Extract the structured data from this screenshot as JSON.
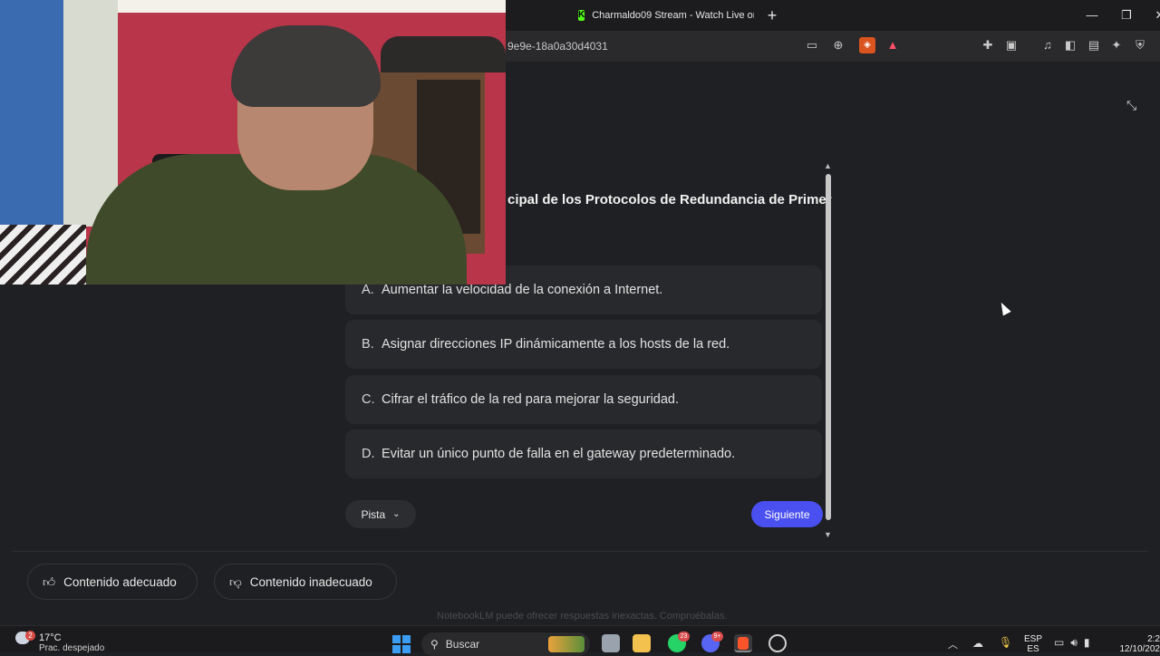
{
  "browser": {
    "tab_title": "Charmaldo09 Stream - Watch Live on",
    "tab_favicon": "kick-icon",
    "url_fragment": "9e9e-18a0a30d4031",
    "window_controls": {
      "minimize": "—",
      "restore": "❐",
      "close": "✕"
    }
  },
  "quiz": {
    "question_fragment": "cipal de los Protocolos de Redundancia de Primer",
    "options": [
      {
        "letter": "A.",
        "text": "Aumentar la velocidad de la conexión a Internet."
      },
      {
        "letter": "B.",
        "text": "Asignar direcciones IP dinámicamente a los hosts de la red."
      },
      {
        "letter": "C.",
        "text": "Cifrar el tráfico de la red para mejorar la seguridad."
      },
      {
        "letter": "D.",
        "text": "Evitar un único punto de falla en el gateway predeterminado."
      }
    ],
    "hint_label": "Pista",
    "next_label": "Siguiente",
    "accent_color": "#4a4ff0"
  },
  "feedback": {
    "good_label": "Contenido adecuado",
    "bad_label": "Contenido inadecuado",
    "disclaimer": "NotebookLM puede ofrecer respuestas inexactas. Compruébalas."
  },
  "taskbar": {
    "weather_badge": "2",
    "weather_temp": "17°C",
    "weather_desc": "Prac. despejado",
    "search_label": "Buscar",
    "whatsapp_badge": "23",
    "discord_badge": "9+",
    "lang_line1": "ESP",
    "lang_line2": "ES",
    "clock_time": "2:2",
    "clock_date": "12/10/202"
  }
}
